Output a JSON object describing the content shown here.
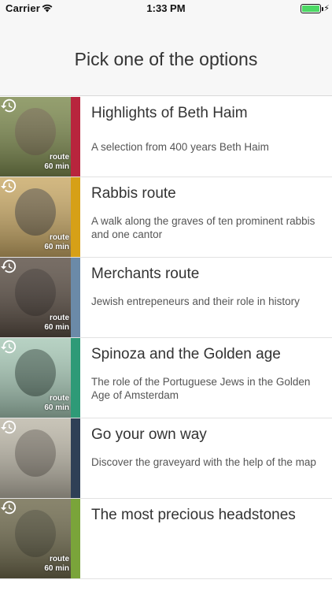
{
  "status_bar": {
    "carrier": "Carrier",
    "time": "1:33 PM",
    "battery_level": 1.0,
    "icons": [
      "wifi-icon",
      "battery-icon",
      "charging-bolt-icon"
    ]
  },
  "header": {
    "title": "Pick one of the options"
  },
  "routes": [
    {
      "title": "Highlights of Beth Haim",
      "description": "A selection from 400 years Beth Haim",
      "tag": "route",
      "duration": "60 min",
      "accent": "#b8253d",
      "thumb_bg": "#7d8a4f",
      "thumb_fg": "#6b5745"
    },
    {
      "title": "Rabbis route",
      "description": "A walk along the graves of ten prominent rabbis and one cantor",
      "tag": "route",
      "duration": "60 min",
      "accent": "#d6a017",
      "thumb_bg": "#c9a966",
      "thumb_fg": "#3d3a35"
    },
    {
      "title": "Merchants route",
      "description": "Jewish entrepeneurs and their role in history",
      "tag": "route",
      "duration": "60 min",
      "accent": "#6b8aa8",
      "thumb_bg": "#5a4e44",
      "thumb_fg": "#2d2520"
    },
    {
      "title": "Spinoza and the Golden age",
      "description": "The role of the Portuguese Jews in the Golden Age of Amsterdam",
      "tag": "route",
      "duration": "60 min",
      "accent": "#2e9a77",
      "thumb_bg": "#a7c8b6",
      "thumb_fg": "#243a30"
    },
    {
      "title": "Go your own way",
      "description": "Discover the graveyard with the help of the map",
      "tag": "",
      "duration": "",
      "accent": "#2f4056",
      "thumb_bg": "#bcb7a8",
      "thumb_fg": "#5c574c"
    },
    {
      "title": "The most precious headstones",
      "description": "",
      "tag": "route",
      "duration": "60 min",
      "accent": "#7aa43a",
      "thumb_bg": "#6f6a4d",
      "thumb_fg": "#3d3a2a"
    }
  ]
}
